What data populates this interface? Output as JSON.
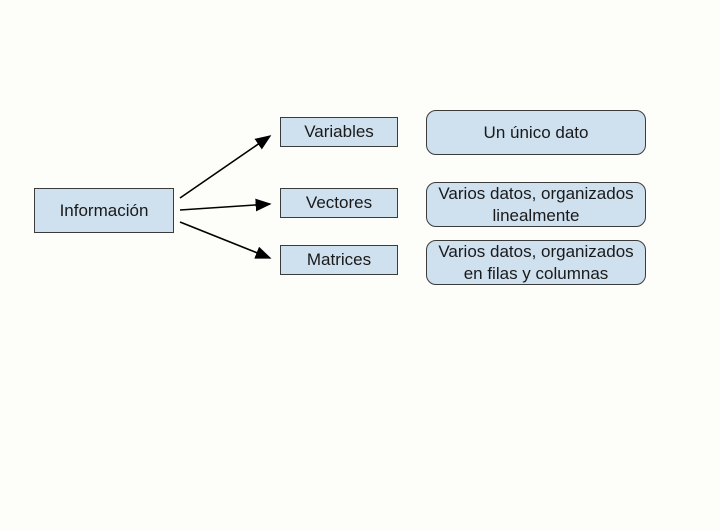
{
  "root": {
    "label": "Información"
  },
  "types": {
    "variables": {
      "label": "Variables",
      "description": "Un único dato"
    },
    "vectores": {
      "label": "Vectores",
      "description": "Varios datos, organizados linealmente"
    },
    "matrices": {
      "label": "Matrices",
      "description": "Varios datos, organizados en filas y columnas"
    }
  },
  "colors": {
    "boxFill": "#cfe0ef",
    "boxStroke": "#3b3b3b",
    "arrow": "#000000"
  }
}
